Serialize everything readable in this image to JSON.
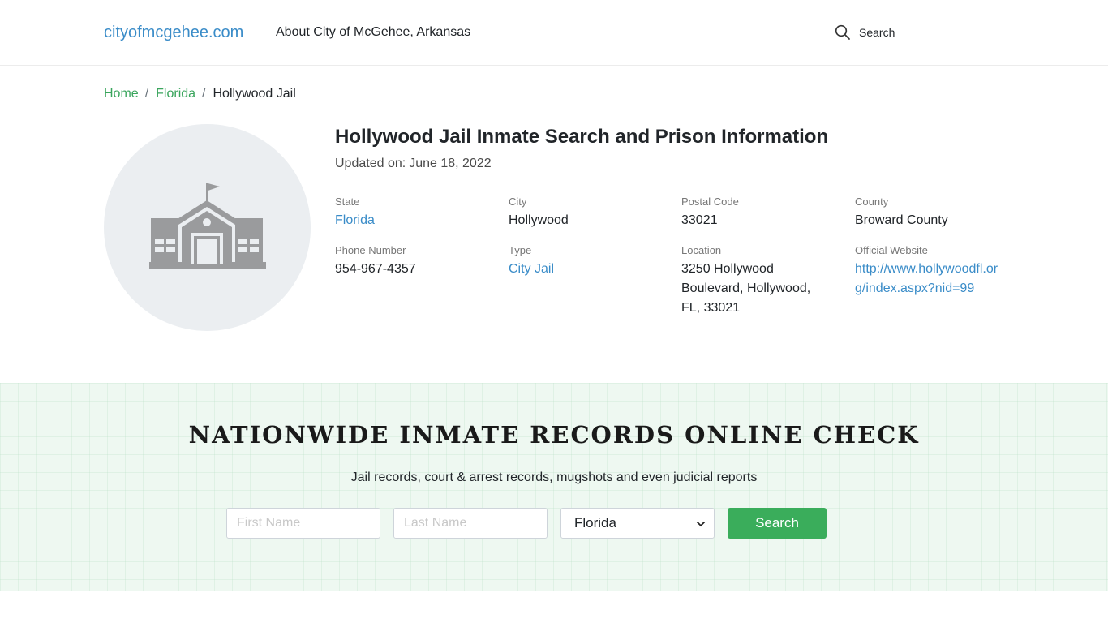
{
  "header": {
    "logo": "cityofmcgehee.com",
    "nav_about": "About City of McGehee, Arkansas",
    "search_label": "Search"
  },
  "breadcrumb": {
    "home": "Home",
    "state": "Florida",
    "current": "Hollywood Jail",
    "separator": "/"
  },
  "facility": {
    "title": "Hollywood Jail Inmate Search and Prison Information",
    "updated_label": "Updated on:",
    "updated_date": "June 18, 2022",
    "image_icon": "building-icon",
    "fields": {
      "state": {
        "label": "State",
        "value": "Florida"
      },
      "city": {
        "label": "City",
        "value": "Hollywood"
      },
      "postal": {
        "label": "Postal Code",
        "value": "33021"
      },
      "county": {
        "label": "County",
        "value": "Broward County"
      },
      "phone": {
        "label": "Phone Number",
        "value": "954-967-4357"
      },
      "type": {
        "label": "Type",
        "value": "City Jail"
      },
      "location": {
        "label": "Location",
        "value": "3250 Hollywood Boulevard, Hollywood, FL, 33021"
      },
      "website": {
        "label": "Official Website",
        "value": "http://www.hollywoodfl.org/index.aspx?nid=99"
      }
    }
  },
  "search_band": {
    "title": "NATIONWIDE INMATE RECORDS ONLINE CHECK",
    "subtitle": "Jail records, court & arrest records, mugshots and even judicial reports",
    "first_name_placeholder": "First Name",
    "last_name_placeholder": "Last Name",
    "state_selected": "Florida",
    "button_label": "Search"
  },
  "colors": {
    "link_blue": "#3a8cc8",
    "link_green": "#3aa55d",
    "button_green": "#3aad5b",
    "band_bg": "#eef8f1"
  }
}
